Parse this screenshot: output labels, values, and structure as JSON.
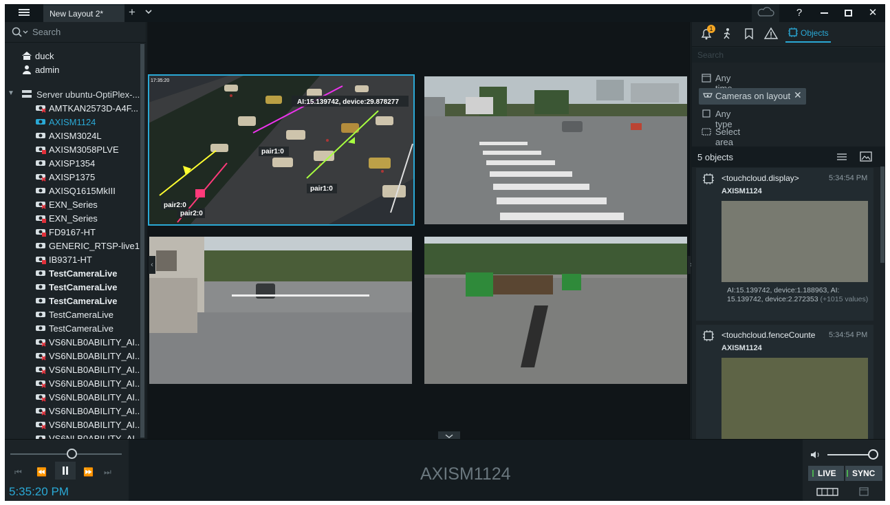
{
  "titlebar": {
    "tab_label": "New Layout 2*",
    "add_tab": "+",
    "tabs_menu": "⌄",
    "help": "?",
    "minimize": "—",
    "maximize": "☐",
    "close": "✕"
  },
  "search": {
    "placeholder": "Search"
  },
  "tree": {
    "users": [
      "duck",
      "admin"
    ],
    "server": "Server ubuntu-OptiPlex-...",
    "cameras": [
      {
        "name": "AMTKAN2573D-A4F...",
        "status": "offline"
      },
      {
        "name": "AXISM1124",
        "status": "selected"
      },
      {
        "name": "AXISM3024L",
        "status": "online"
      },
      {
        "name": "AXISM3058PLVE",
        "status": "locked"
      },
      {
        "name": "AXISP1354",
        "status": "online"
      },
      {
        "name": "AXISP1375",
        "status": "offline"
      },
      {
        "name": "AXISQ1615MkIII",
        "status": "online"
      },
      {
        "name": "EXN_Series",
        "status": "offline"
      },
      {
        "name": "EXN_Series",
        "status": "locked"
      },
      {
        "name": "FD9167-HT",
        "status": "locked"
      },
      {
        "name": "GENERIC_RTSP-live1...",
        "status": "online"
      },
      {
        "name": "IB9371-HT",
        "status": "locked"
      },
      {
        "name": "TestCameraLive",
        "status": "live"
      },
      {
        "name": "TestCameraLive",
        "status": "live"
      },
      {
        "name": "TestCameraLive",
        "status": "live"
      },
      {
        "name": "TestCameraLive",
        "status": "online"
      },
      {
        "name": "TestCameraLive",
        "status": "online"
      },
      {
        "name": "VS6NLB0ABILITY_AI...",
        "status": "offline"
      },
      {
        "name": "VS6NLB0ABILITY_AI...",
        "status": "offline"
      },
      {
        "name": "VS6NLB0ABILITY_AI...",
        "status": "offline"
      },
      {
        "name": "VS6NLB0ABILITY_AI...",
        "status": "offline"
      },
      {
        "name": "VS6NLB0ABILITY_AI...",
        "status": "offline"
      },
      {
        "name": "VS6NLB0ABILITY_AI...",
        "status": "offline"
      },
      {
        "name": "VS6NLB0ABILITY_AI...",
        "status": "offline"
      },
      {
        "name": "VS6NLB0ABILITY_AI...",
        "status": "offline"
      }
    ]
  },
  "overlay": {
    "timestamp": "17:35:20",
    "info": "AI:15.139742, device:29.878277",
    "labels": [
      "pair1:0",
      "pair1:0",
      "pair2:0",
      "pair2:0"
    ]
  },
  "right": {
    "notification_count": "1",
    "objects_tab": "Objects",
    "search_placeholder": "Search",
    "filters": [
      "Any time",
      "Cameras on layout",
      "Any type",
      "Select area"
    ],
    "count_label": "5 objects",
    "cards": [
      {
        "title": "<touchcloud.display>",
        "time": "5:34:54 PM",
        "camera": "AXISM1124",
        "desc": "AI:15.139742, device:1.188963, AI: 15.139742, device:2.272353",
        "more": "(+1015 values)"
      },
      {
        "title": "<touchcloud.fenceCounte",
        "time": "5:34:54 PM",
        "camera": "AXISM1124"
      }
    ]
  },
  "bottom": {
    "camera_name": "AXISM1124",
    "time": "5:35:20 PM",
    "live_label": "LIVE",
    "sync_label": "SYNC",
    "volume": 0.9,
    "seek": 0.55
  },
  "colors": {
    "accent": "#2aa9d6",
    "offline": "#e0303a",
    "panel": "#1c2327"
  }
}
